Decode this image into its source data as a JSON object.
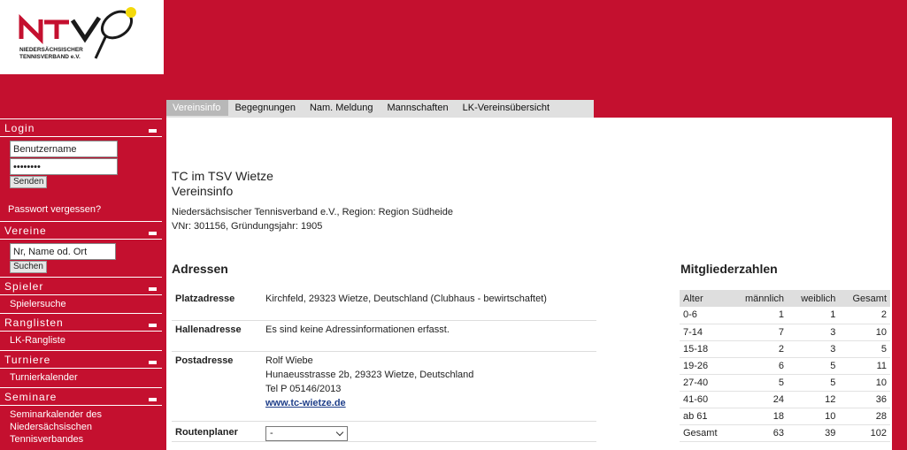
{
  "logo": {
    "text_line1": "NIEDERSÄCHSISCHER",
    "text_line2": "TENNISVERBAND e.V."
  },
  "sidebar": {
    "login": {
      "title": "Login",
      "username_value": "Benutzername",
      "password_value": "••••••••",
      "submit_label": "Senden",
      "forgot_label": "Passwort vergessen?"
    },
    "vereine": {
      "title": "Vereine",
      "search_placeholder": "Nr, Name od. Ort",
      "search_label": "Suchen"
    },
    "spieler": {
      "title": "Spieler",
      "link": "Spielersuche"
    },
    "ranglisten": {
      "title": "Ranglisten",
      "link": "LK-Rangliste"
    },
    "turniere": {
      "title": "Turniere",
      "link": "Turnierkalender"
    },
    "seminare": {
      "title": "Seminare",
      "link_line1": "Seminarkalender des",
      "link_line2": "Niedersächsischen",
      "link_line3": "Tennisverbandes"
    }
  },
  "tabs": [
    "Vereinsinfo",
    "Begegnungen",
    "Nam. Meldung",
    "Mannschaften",
    "LK-Vereinsübersicht"
  ],
  "club": {
    "name": "TC im TSV Wietze",
    "subtitle": "Vereinsinfo",
    "info_line1": "Niedersächsischer Tennisverband e.V., Region: Region Südheide",
    "info_line2": "VNr: 301156, Gründungsjahr: 1905"
  },
  "addresses": {
    "heading": "Adressen",
    "platz": {
      "label": "Platzadresse",
      "value": "Kirchfeld, 29323 Wietze, Deutschland (Clubhaus - bewirtschaftet)"
    },
    "halle": {
      "label": "Hallenadresse",
      "value": "Es sind keine Adressinformationen erfasst."
    },
    "post": {
      "label": "Postadresse",
      "name": "Rolf Wiebe",
      "street": "Hunaeusstrasse 2b, 29323 Wietze, Deutschland",
      "phone": "Tel P 05146/2013",
      "website": "www.tc-wietze.de"
    },
    "route": {
      "label": "Routenplaner",
      "selected": "-"
    }
  },
  "members": {
    "heading": "Mitgliederzahlen",
    "columns": [
      "Alter",
      "männlich",
      "weiblich",
      "Gesamt"
    ],
    "rows": [
      [
        "0-6",
        "1",
        "1",
        "2"
      ],
      [
        "7-14",
        "7",
        "3",
        "10"
      ],
      [
        "15-18",
        "2",
        "3",
        "5"
      ],
      [
        "19-26",
        "6",
        "5",
        "11"
      ],
      [
        "27-40",
        "5",
        "5",
        "10"
      ],
      [
        "41-60",
        "24",
        "12",
        "36"
      ],
      [
        "ab 61",
        "18",
        "10",
        "28"
      ],
      [
        "Gesamt",
        "63",
        "39",
        "102"
      ]
    ]
  },
  "colors": {
    "brand": "#c4102f",
    "tab_bar": "#e0e0e0",
    "tab_active": "#b8b8b8",
    "link": "#1f3f8a"
  }
}
